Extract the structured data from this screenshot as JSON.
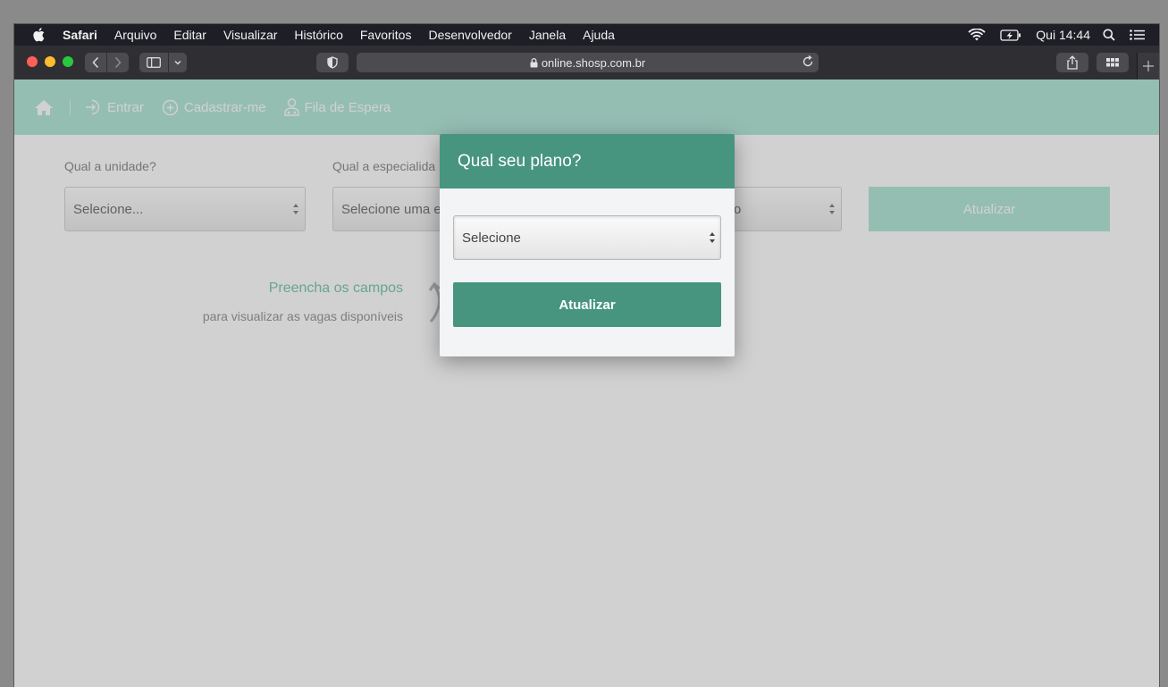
{
  "menubar": {
    "app_name": "Safari",
    "items": [
      "Arquivo",
      "Editar",
      "Visualizar",
      "Histórico",
      "Favoritos",
      "Desenvolvedor",
      "Janela",
      "Ajuda"
    ],
    "clock": "Qui 14:44"
  },
  "toolbar": {
    "url": "online.shosp.com.br"
  },
  "navbar": {
    "items": [
      "Entrar",
      "Cadastrar-me",
      "Fila de Espera"
    ]
  },
  "form": {
    "unit_label": "Qual a unidade?",
    "unit_value": "Selecione...",
    "specialty_label": "Qual a especialida",
    "specialty_value": "Selecione uma e",
    "third_value": "o",
    "update_label": "Atualizar"
  },
  "empty_state": {
    "title": "Preencha os campos",
    "subtitle": "para visualizar as vagas disponíveis"
  },
  "modal": {
    "title": "Qual seu plano?",
    "select_value": "Selecione",
    "button_label": "Atualizar",
    "accent_color": "#47957f"
  },
  "colors": {
    "navbar": "#b6e8db",
    "modal_header": "#47957f"
  }
}
